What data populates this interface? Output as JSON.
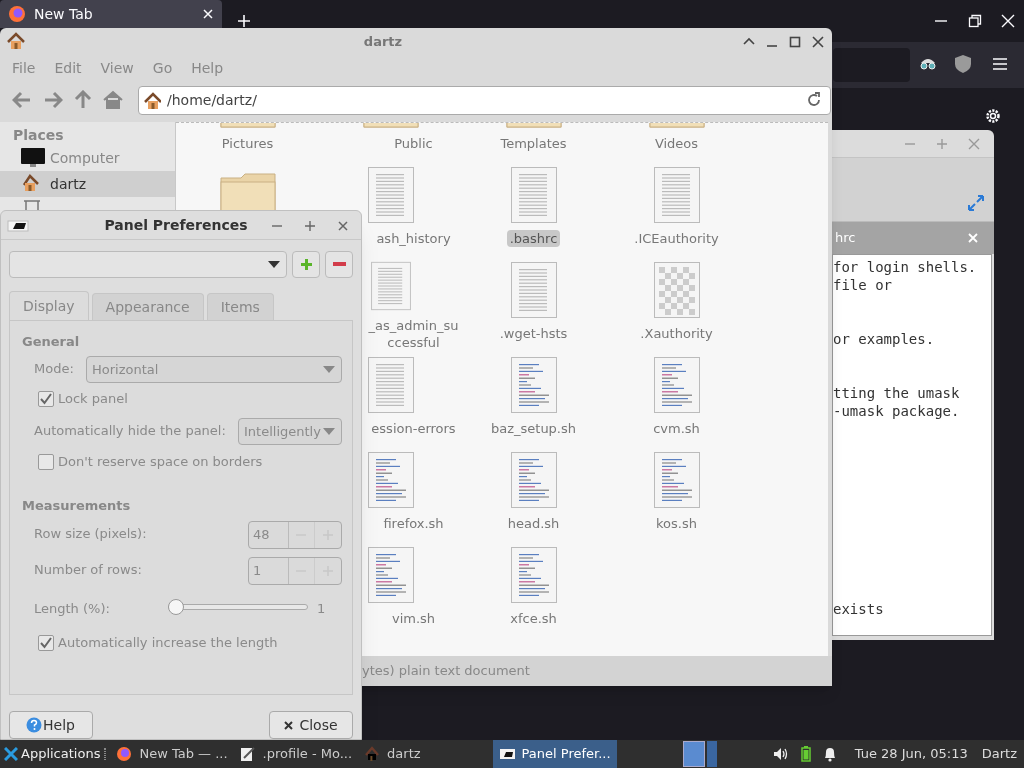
{
  "browser": {
    "tab_title": "New Tab"
  },
  "editor": {
    "tab_label": "hrc",
    "lines": [
      "for login shells.",
      "file or",
      "or examples.",
      "tting the umask",
      "-umask package.",
      "exists"
    ]
  },
  "file_manager": {
    "title": "dartz",
    "menu": [
      "File",
      "Edit",
      "View",
      "Go",
      "Help"
    ],
    "path": "/home/dartz/",
    "places_heading": "Places",
    "places": [
      {
        "label": "Computer",
        "kind": "computer",
        "selected": false
      },
      {
        "label": "dartz",
        "kind": "home",
        "selected": true
      }
    ],
    "rows": [
      [
        {
          "label": "Pictures",
          "kind": "folder",
          "selected": false
        },
        {
          "label": "Public",
          "kind": "folder",
          "selected": false
        },
        {
          "label": "Templates",
          "kind": "folder",
          "selected": false
        },
        {
          "label": "Videos",
          "kind": "folder",
          "selected": false
        }
      ],
      [
        {
          "kind": "folder",
          "selected": false
        },
        {
          "label": "ash_history",
          "kind": "text",
          "selected": false
        },
        {
          "label": ".bashrc",
          "kind": "text",
          "selected": true
        },
        {
          "label": ".ICEauthority",
          "kind": "text",
          "selected": false
        }
      ],
      [
        null,
        {
          "label": "_as_admin_su\nccessful",
          "kind": "text",
          "selected": false
        },
        {
          "label": ".wget-hsts",
          "kind": "text",
          "selected": false
        },
        {
          "label": ".Xauthority",
          "kind": "image",
          "selected": false
        }
      ],
      [
        null,
        {
          "label": "ession-errors",
          "kind": "text",
          "selected": false
        },
        {
          "label": "baz_setup.sh",
          "kind": "script",
          "selected": false
        },
        {
          "label": "cvm.sh",
          "kind": "script",
          "selected": false
        }
      ],
      [
        null,
        {
          "label": "firefox.sh",
          "kind": "script",
          "selected": false
        },
        {
          "label": "head.sh",
          "kind": "script",
          "selected": false
        },
        {
          "label": "kos.sh",
          "kind": "script",
          "selected": false
        }
      ],
      [
        null,
        {
          "label": "vim.sh",
          "kind": "script",
          "selected": false
        },
        {
          "label": "xfce.sh",
          "kind": "script",
          "selected": false
        }
      ]
    ],
    "status": "ytes) plain text document"
  },
  "panel_preferences": {
    "title": "Panel Preferences",
    "tabs": [
      {
        "label": "Display",
        "selected": true
      },
      {
        "label": "Appearance",
        "selected": false
      },
      {
        "label": "Items",
        "selected": false
      }
    ],
    "general_heading": "General",
    "mode_label": "Mode:",
    "mode_value": "Horizontal",
    "lock_panel": {
      "label": "Lock panel",
      "checked": true
    },
    "autohide_label": "Automatically hide the panel:",
    "autohide_value": "Intelligently",
    "dont_reserve": {
      "label": "Don't reserve space on borders",
      "checked": false
    },
    "measurements_heading": "Measurements",
    "row_size": {
      "label": "Row size (pixels):",
      "value": "48"
    },
    "number_of_rows": {
      "label": "Number of rows:",
      "value": "1"
    },
    "length": {
      "label": "Length (%):",
      "level": 0.01,
      "reading": "1"
    },
    "auto_increase": {
      "label": "Automatically increase the length",
      "checked": true
    },
    "help_button": "Help",
    "close_button": "Close"
  },
  "taskbar": {
    "menu": "Applications",
    "tasks": [
      {
        "label": "New Tab — ...",
        "kind": "browser",
        "selected": false
      },
      {
        "label": ".profile - Mo...",
        "kind": "editor",
        "selected": false
      },
      {
        "label": "dartz",
        "kind": "home",
        "selected": false
      },
      {
        "label": "Panel Prefer...",
        "kind": "panel",
        "selected": true
      }
    ],
    "clock": "Tue 28 Jun, 05:13",
    "user": "Dartz"
  }
}
